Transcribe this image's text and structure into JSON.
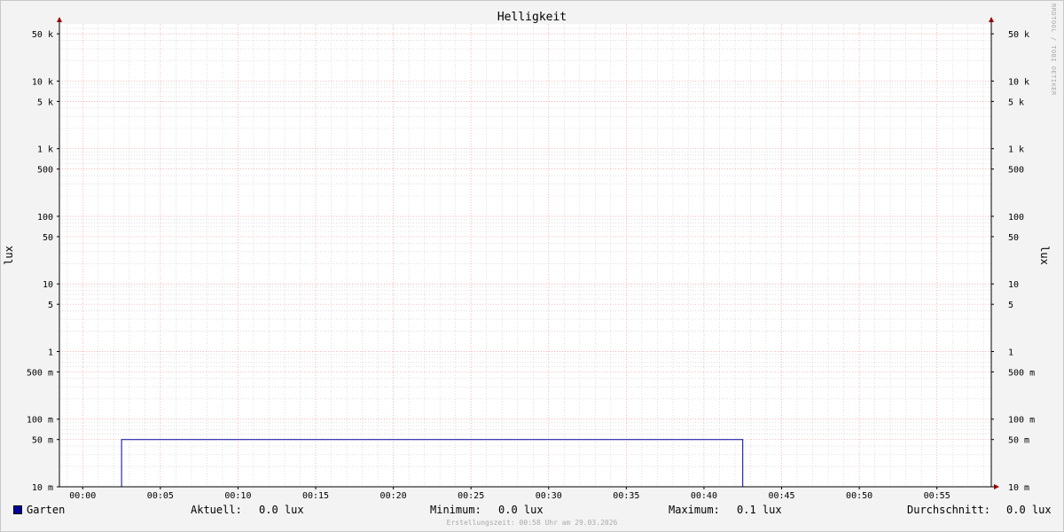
{
  "chart_data": {
    "type": "line",
    "title": "Helligkeit",
    "ylabel": "lux",
    "yscale": "log",
    "ylim": [
      0.01,
      70000
    ],
    "xlim_minutes": [
      -1.5,
      58.5
    ],
    "x_ticks": [
      "00:00",
      "00:05",
      "00:10",
      "00:15",
      "00:20",
      "00:25",
      "00:30",
      "00:35",
      "00:40",
      "00:45",
      "00:50",
      "00:55"
    ],
    "y_ticks": [
      {
        "value": 0.01,
        "label": "10 m"
      },
      {
        "value": 0.05,
        "label": "50 m"
      },
      {
        "value": 0.1,
        "label": "100 m"
      },
      {
        "value": 0.5,
        "label": "500 m"
      },
      {
        "value": 1,
        "label": "1"
      },
      {
        "value": 5,
        "label": "5"
      },
      {
        "value": 10,
        "label": "10"
      },
      {
        "value": 50,
        "label": "50"
      },
      {
        "value": 100,
        "label": "100"
      },
      {
        "value": 500,
        "label": "500"
      },
      {
        "value": 1000,
        "label": "1 k"
      },
      {
        "value": 5000,
        "label": "5 k"
      },
      {
        "value": 10000,
        "label": "10 k"
      },
      {
        "value": 50000,
        "label": "50 k"
      }
    ],
    "grid": true,
    "series": [
      {
        "name": "Garten",
        "color": "#000099",
        "points": [
          {
            "x": "23:58:30",
            "y": 0.01
          },
          {
            "x": "00:02:30",
            "y": 0.01
          },
          {
            "x": "00:02:30",
            "y": 0.05
          },
          {
            "x": "00:42:30",
            "y": 0.05
          },
          {
            "x": "00:42:30",
            "y": 0.01
          },
          {
            "x": "00:58:30",
            "y": 0.01
          }
        ]
      }
    ]
  },
  "legend": {
    "series_label": "Garten",
    "current_label": "Aktuell:",
    "current_value": "0.0 lux",
    "min_label": "Minimum:",
    "min_value": "0.0 lux",
    "max_label": "Maximum:",
    "max_value": "0.1 lux",
    "avg_label": "Durchschnitt:",
    "avg_value": "0.0 lux"
  },
  "footer": "Erstellungszeit: 00:58 Uhr am 29.03.2026",
  "watermark": "RRDTOOL / TOBI OETIKER",
  "colors": {
    "series": "#000099",
    "major_grid": "#ff9999",
    "minor_grid": "#cccccc",
    "axis_arrow": "#990000"
  }
}
